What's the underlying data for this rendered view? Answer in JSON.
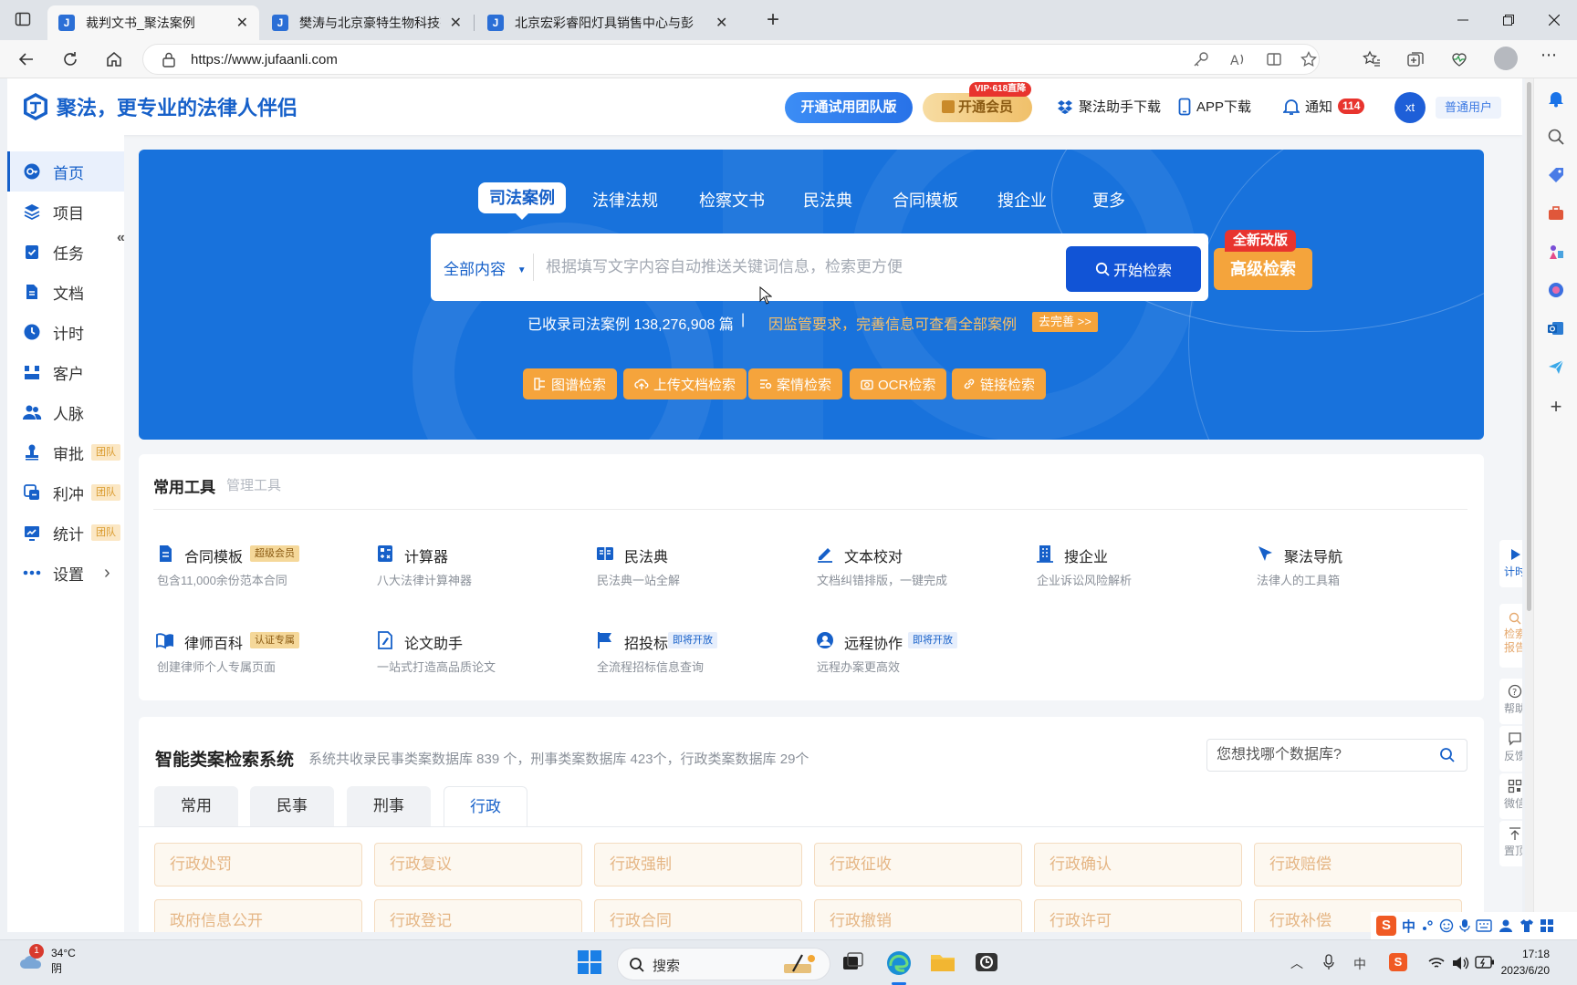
{
  "browser": {
    "tabs": [
      {
        "title": "裁判文书_聚法案例",
        "active": true
      },
      {
        "title": "樊涛与北京豪特生物科技有限公司",
        "active": false
      },
      {
        "title": "北京宏彩睿阳灯具销售中心与彭",
        "active": false
      }
    ],
    "new_tab_label": "+",
    "url": "https://www.jufaanli.com"
  },
  "header": {
    "logo_text": "聚法，更专业的法律人伴侣",
    "team_trial_label": "开通试用团队版",
    "vip_label": "开通会员",
    "vip_tag": "VIP·618直降",
    "assistant_download": "聚法助手下载",
    "app_download": "APP下载",
    "notify_label": "通知",
    "notify_count": "114",
    "avatar_text": "xt",
    "user_type": "普通用户"
  },
  "sidebar": {
    "collapse_label": "«",
    "items": [
      {
        "label": "首页",
        "icon": "home-icon",
        "active": true
      },
      {
        "label": "项目",
        "icon": "layers-icon"
      },
      {
        "label": "任务",
        "icon": "task-icon"
      },
      {
        "label": "文档",
        "icon": "document-icon"
      },
      {
        "label": "计时",
        "icon": "clock-icon"
      },
      {
        "label": "客户",
        "icon": "client-icon"
      },
      {
        "label": "人脉",
        "icon": "contacts-icon"
      },
      {
        "label": "审批",
        "icon": "stamp-icon",
        "tag": "团队"
      },
      {
        "label": "利冲",
        "icon": "conflict-icon",
        "tag": "团队"
      },
      {
        "label": "统计",
        "icon": "chart-icon",
        "tag": "团队"
      },
      {
        "label": "设置",
        "icon": "more-icon",
        "arrow": "›"
      }
    ]
  },
  "hero": {
    "tabs": [
      "司法案例",
      "法律法规",
      "检察文书",
      "民法典",
      "合同模板",
      "搜企业",
      "更多"
    ],
    "selected_tab": "司法案例",
    "category": "全部内容",
    "search_placeholder": "根据填写文字内容自动推送关键词信息，检索更方便",
    "search_button": "开始检索",
    "advanced_tag": "全新改版",
    "advanced_button": "高级检索",
    "stat_text": "已收录司法案例 138,276,908  篇",
    "stat_sep": "|",
    "notice_text": "因监管要求，完善信息可查看全部案例",
    "improve_label": "去完善 >>",
    "quick_buttons": [
      "图谱检索",
      "上传文档检索",
      "案情检索",
      "OCR检索",
      "链接检索"
    ]
  },
  "tools": {
    "title": "常用工具",
    "manage": "管理工具",
    "items": [
      {
        "name": "合同模板",
        "desc": "包含11,000余份范本合同",
        "badge": "超级会员",
        "icon": "contract-icon"
      },
      {
        "name": "计算器",
        "desc": "八大法律计算神器",
        "icon": "calculator-icon"
      },
      {
        "name": "民法典",
        "desc": "民法典一站全解",
        "icon": "book-icon"
      },
      {
        "name": "文本校对",
        "desc": "文档纠错排版，一键完成",
        "icon": "pen-icon"
      },
      {
        "name": "搜企业",
        "desc": "企业诉讼风险解析",
        "icon": "building-icon"
      },
      {
        "name": "聚法导航",
        "desc": "法律人的工具箱",
        "icon": "navigation-icon"
      },
      {
        "name": "律师百科",
        "desc": "创建律师个人专属页面",
        "badge": "认证专属",
        "icon": "encyclopedia-icon"
      },
      {
        "name": "论文助手",
        "desc": "一站式打造高品质论文",
        "icon": "paper-icon"
      },
      {
        "name": "招投标",
        "desc": "全流程招标信息查询",
        "badge": "即将开放",
        "icon": "flag-icon"
      },
      {
        "name": "远程协作",
        "desc": "远程办案更高效",
        "badge": "即将开放",
        "icon": "collab-icon"
      }
    ]
  },
  "similar": {
    "title": "智能类案检索系统",
    "desc": "系统共收录民事类案数据库 839 个，刑事类案数据库 423个，行政类案数据库 29个",
    "search_placeholder": "您想找哪个数据库?",
    "tabs": [
      "常用",
      "民事",
      "刑事",
      "行政"
    ],
    "selected_tab": "行政",
    "chips": [
      "行政处罚",
      "行政复议",
      "行政强制",
      "行政征收",
      "行政确认",
      "行政赔偿",
      "政府信息公开",
      "行政登记",
      "行政合同",
      "行政撤销",
      "行政许可",
      "行政补偿"
    ]
  },
  "floaters": [
    {
      "label": "计时",
      "icon": "play-icon"
    },
    {
      "label": "检索报告",
      "icon": "search-report-icon"
    },
    {
      "label": "帮助",
      "icon": "help-icon"
    },
    {
      "label": "反馈",
      "icon": "feedback-icon"
    },
    {
      "label": "微信",
      "icon": "qrcode-icon"
    },
    {
      "label": "置顶",
      "icon": "back-to-top-icon"
    }
  ],
  "taskbar": {
    "weather_badge": "1",
    "temperature": "34°C",
    "weather": "阴",
    "search_label": "搜索",
    "time": "17:18",
    "date": "2023/6/20",
    "ime_label": "中"
  },
  "colors": {
    "brand_blue": "#1660c9",
    "hero_blue": "#1872dc",
    "orange": "#f5a43c",
    "red": "#e8342e"
  }
}
